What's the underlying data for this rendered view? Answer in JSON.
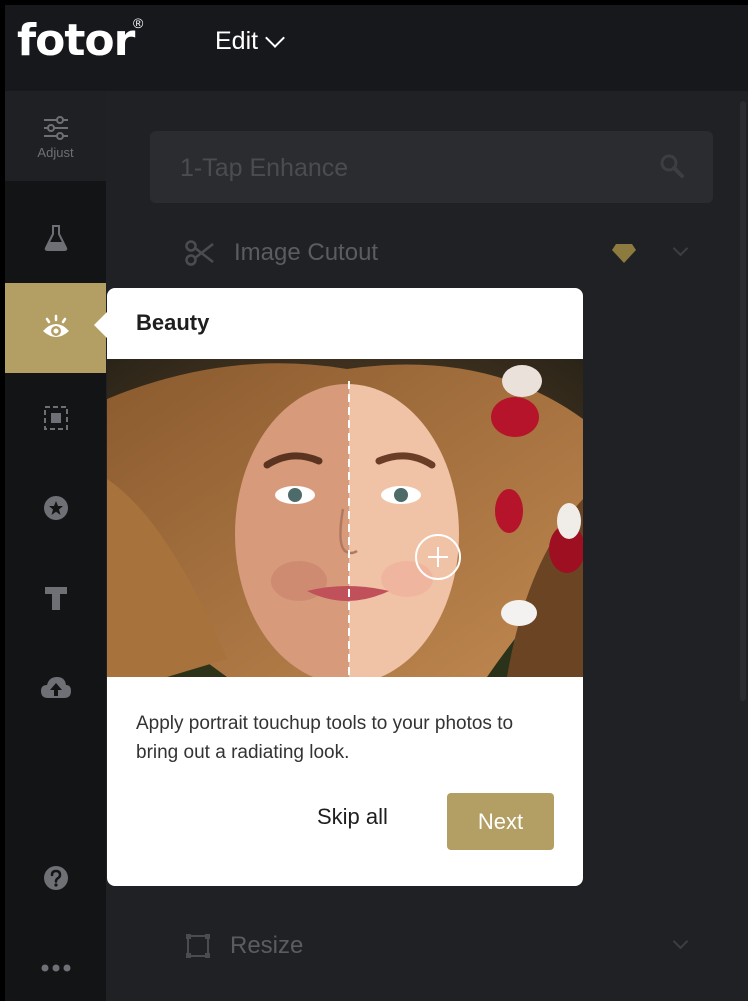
{
  "app": {
    "logo_text": "fotor",
    "logo_mark": "®",
    "menu_label": "Edit"
  },
  "rail": {
    "items": [
      {
        "icon": "sliders-icon",
        "label": "Adjust"
      },
      {
        "icon": "flask-icon"
      },
      {
        "icon": "eye-icon",
        "active": true
      },
      {
        "icon": "frame-icon"
      },
      {
        "icon": "sticker-icon"
      },
      {
        "icon": "text-icon"
      },
      {
        "icon": "cloud-upload-icon"
      },
      {
        "icon": "help-icon"
      },
      {
        "icon": "more-icon"
      }
    ]
  },
  "panel": {
    "search_placeholder": "1-Tap Enhance",
    "tools": [
      {
        "label": "Image Cutout",
        "icon": "scissors-icon",
        "premium": true
      },
      {
        "label": "Resize",
        "icon": "resize-icon"
      }
    ]
  },
  "tooltip": {
    "title": "Beauty",
    "description": "Apply portrait touchup tools to your photos to bring out a radiating look.",
    "skip_label": "Skip all",
    "next_label": "Next"
  },
  "colors": {
    "accent": "#b39e63",
    "background": "#1f2023",
    "rail": "#131416"
  }
}
